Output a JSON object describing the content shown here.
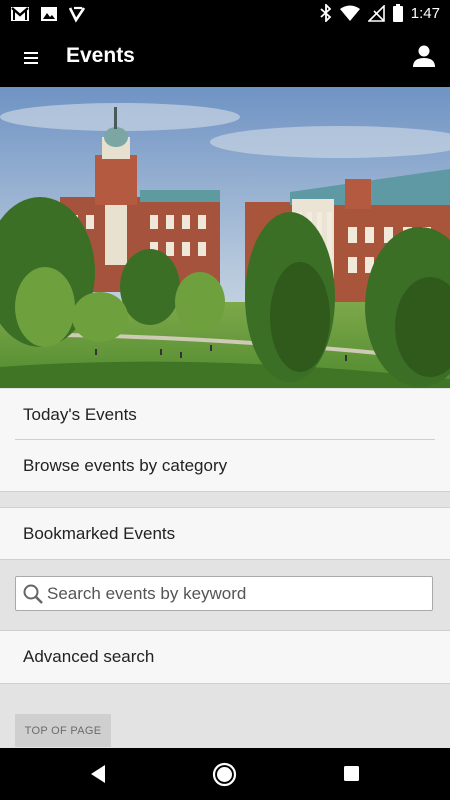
{
  "status_bar": {
    "time": "1:47",
    "left_icons": [
      "gmail-icon",
      "image-icon",
      "app-check-icon"
    ],
    "right_icons": [
      "bluetooth-icon",
      "wifi-icon",
      "no-signal-icon",
      "battery-icon"
    ]
  },
  "app_bar": {
    "title": "Events",
    "menu_icon": "hamburger-menu-icon",
    "account_icon": "account-icon"
  },
  "hero": {
    "description_icon": "campus-photo"
  },
  "menu": {
    "todays_events": "Today's Events",
    "browse_by_category": "Browse events by category",
    "bookmarked_events": "Bookmarked Events",
    "advanced_search": "Advanced search"
  },
  "search": {
    "placeholder": "Search events by keyword",
    "value": ""
  },
  "top_of_page": "TOP OF PAGE",
  "nav_bar": {
    "icons": [
      "back-icon",
      "home-icon",
      "recents-icon"
    ]
  }
}
